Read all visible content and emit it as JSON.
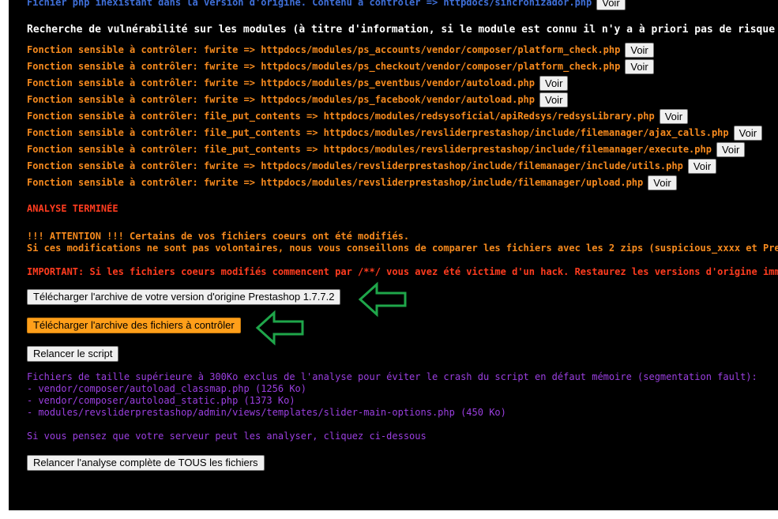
{
  "top_line": {
    "text": "Fichier php inexistant dans la version d'origine. Contenu à contrôler => httpdocs/sincronizador.php",
    "button": "Voir"
  },
  "module_scan": {
    "heading": "Recherche de vulnérabilité sur les modules (à titre d'information, si le module est connu il n'y a à priori pas de risque",
    "items": [
      {
        "text": "Fonction sensible à contrôler: fwrite => httpdocs/modules/ps_accounts/vendor/composer/platform_check.php",
        "button": "Voir"
      },
      {
        "text": "Fonction sensible à contrôler: fwrite => httpdocs/modules/ps_checkout/vendor/composer/platform_check.php",
        "button": "Voir"
      },
      {
        "text": "Fonction sensible à contrôler: fwrite => httpdocs/modules/ps_eventbus/vendor/autoload.php",
        "button": "Voir"
      },
      {
        "text": "Fonction sensible à contrôler: fwrite => httpdocs/modules/ps_facebook/vendor/autoload.php",
        "button": "Voir"
      },
      {
        "text": "Fonction sensible à contrôler: file_put_contents => httpdocs/modules/redsysoficial/apiRedsys/redsysLibrary.php",
        "button": "Voir"
      },
      {
        "text": "Fonction sensible à contrôler: file_put_contents => httpdocs/modules/revsliderprestashop/include/filemanager/ajax_calls.php",
        "button": "Voir"
      },
      {
        "text": "Fonction sensible à contrôler: file_put_contents => httpdocs/modules/revsliderprestashop/include/filemanager/execute.php",
        "button": "Voir"
      },
      {
        "text": "Fonction sensible à contrôler: fwrite => httpdocs/modules/revsliderprestashop/include/filemanager/include/utils.php",
        "button": "Voir"
      },
      {
        "text": "Fonction sensible à contrôler: fwrite => httpdocs/modules/revsliderprestashop/include/filemanager/upload.php",
        "button": "Voir"
      }
    ]
  },
  "analysis_done": "ANALYSE TERMINÉE",
  "attention": {
    "line1": "!!! ATTENTION !!! Certains de vos fichiers coeurs ont été modifiés.",
    "line2": "Si ces modifications ne sont pas volontaires, nous vous conseillons de comparer les fichiers avec les 2 zips (suspicious_xxxx et Pres"
  },
  "important": "IMPORTANT: Si les fichiers coeurs modifiés commencent par /**/ vous avez été victime d'un hack. Restaurez les versions d'origine immé",
  "buttons": {
    "download_original": "Télécharger l'archive de votre version d'origine Prestashop 1.7.7.2",
    "download_check": "Télécharger l'archive des fichiers à contrôler",
    "rerun": "Relancer le script",
    "rerun_full": "Relancer l'analyse complète de TOUS les fichiers"
  },
  "excluded": {
    "heading": "Fichiers de taille supérieure à 300Ko exclus de l'analyse pour éviter le crash du script en défaut mémoire (segmentation fault):",
    "files": [
      "- vendor/composer/autoload_classmap.php (1256 Ko)",
      "- vendor/composer/autoload_static.php (1373 Ko)",
      "- modules/revsliderprestashop/admin/views/templates/slider-main-options.php (450 Ko)"
    ],
    "note": "Si vous pensez que votre serveur peut les analyser, cliquez ci-dessous"
  },
  "colors": {
    "background": "#000000",
    "blue_text": "#3f6fd8",
    "orange_text": "#f68a1e",
    "red_text": "#ff3c1f",
    "purple_text": "#9b3fe0",
    "highlight_button": "#ff9f1a",
    "arrow": "#1fa64a"
  },
  "icons": [
    "arrow-left-icon",
    "arrow-left-icon"
  ]
}
